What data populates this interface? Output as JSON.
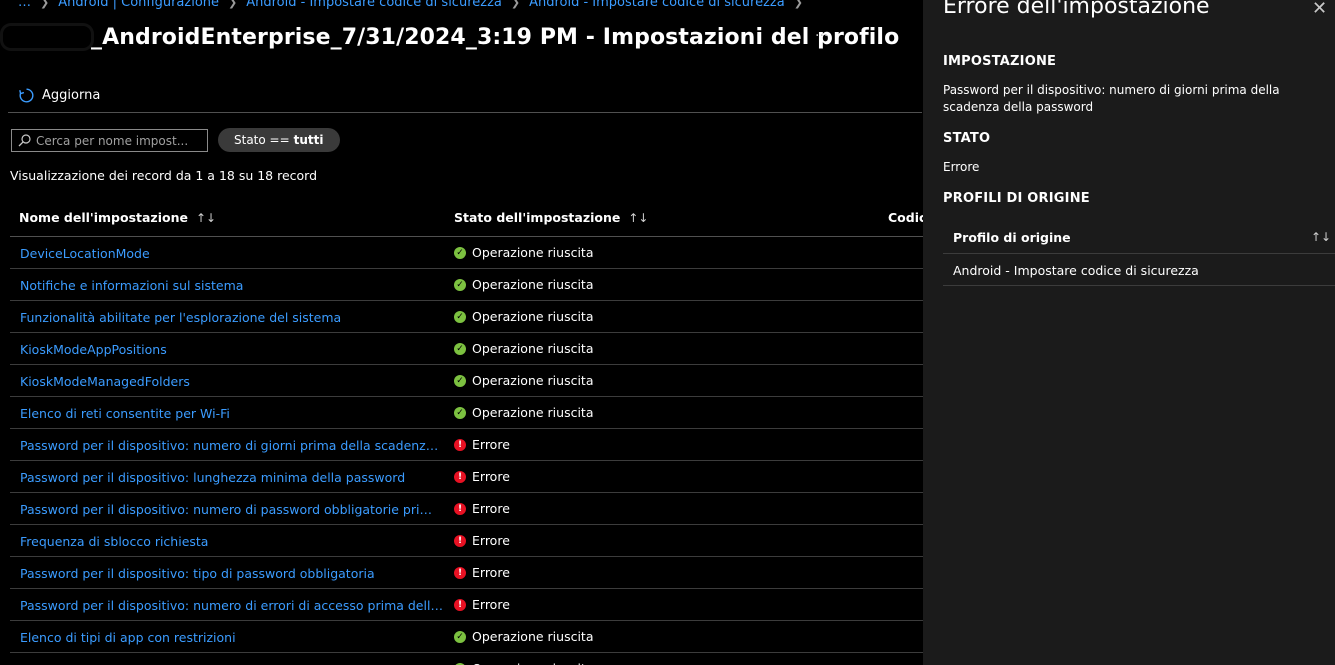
{
  "breadcrumb": {
    "more": "…",
    "items": [
      "Android | Configurazione",
      "Android - Impostare codice di sicurezza",
      "Android - Impostare codice di sicurezza"
    ]
  },
  "header": {
    "title": "_AndroidEnterprise_7/31/2024_3:19 PM - Impostazioni del profilo",
    "more": "···"
  },
  "toolbar": {
    "refresh_label": "Aggiorna"
  },
  "filters": {
    "search_placeholder": "Cerca per nome impost...",
    "status_pill_label": "Stato ==",
    "status_pill_value": "tutti"
  },
  "records_text": "Visualizzazione dei record da 1 a 18 su 18 record",
  "table": {
    "columns": [
      "Nome dell'impostazione",
      "Stato dell'impostazione",
      "Codice"
    ],
    "sort_icon": "↑↓",
    "rows": [
      {
        "name": "DeviceLocationMode",
        "status": "Operazione riuscita",
        "type": "ok"
      },
      {
        "name": "Notifiche e informazioni sul sistema",
        "status": "Operazione riuscita",
        "type": "ok"
      },
      {
        "name": "Funzionalità abilitate per l'esplorazione del sistema",
        "status": "Operazione riuscita",
        "type": "ok"
      },
      {
        "name": "KioskModeAppPositions",
        "status": "Operazione riuscita",
        "type": "ok"
      },
      {
        "name": "KioskModeManagedFolders",
        "status": "Operazione riuscita",
        "type": "ok"
      },
      {
        "name": "Elenco di reti consentite per Wi-Fi",
        "status": "Operazione riuscita",
        "type": "ok"
      },
      {
        "name": "Password per il dispositivo: numero di giorni prima della scadenza della password",
        "status": "Errore",
        "type": "err"
      },
      {
        "name": "Password per il dispositivo: lunghezza minima della password",
        "status": "Errore",
        "type": "err"
      },
      {
        "name": "Password per il dispositivo: numero di password obbligatorie prima che sia possibile riutilizzare una password",
        "status": "Errore",
        "type": "err"
      },
      {
        "name": "Frequenza di sblocco richiesta",
        "status": "Errore",
        "type": "err"
      },
      {
        "name": "Password per il dispositivo: tipo di password obbligatoria",
        "status": "Errore",
        "type": "err"
      },
      {
        "name": "Password per il dispositivo: numero di errori di accesso prima della cancellazione",
        "status": "Errore",
        "type": "err"
      },
      {
        "name": "Elenco di tipi di app con restrizioni",
        "status": "Operazione riuscita",
        "type": "ok"
      },
      {
        "name": "",
        "status": "Operazione riuscita",
        "type": "ok"
      }
    ]
  },
  "panel": {
    "title": "Errore dell'impostazione",
    "close": "✕",
    "setting_heading": "IMPOSTAZIONE",
    "setting_value": "Password per il dispositivo: numero di giorni prima della scadenza della password",
    "state_heading": "STATO",
    "state_value": "Errore",
    "origin_heading": "PROFILI DI ORIGINE",
    "origin_column": "Profilo di origine",
    "origin_sort": "↑↓",
    "origin_rows": [
      "Android - Impostare codice di sicurezza"
    ]
  },
  "colors": {
    "link": "#3b9cff",
    "success": "#7cc140",
    "error": "#e81123",
    "panel_bg": "#1b1b1b"
  }
}
